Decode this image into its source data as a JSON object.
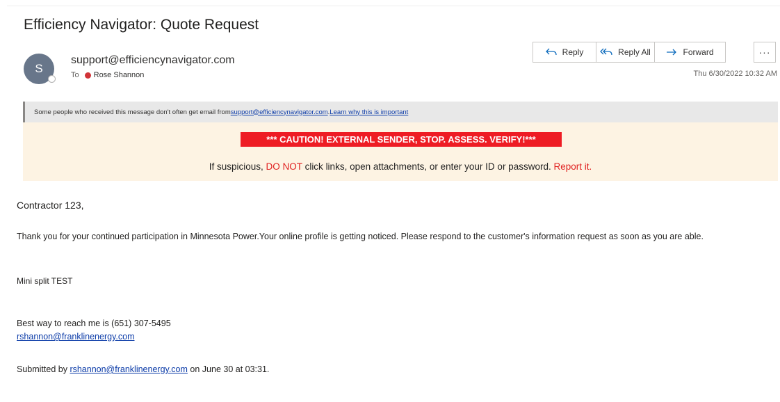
{
  "email": {
    "subject": "Efficiency Navigator: Quote Request",
    "avatar_initial": "S",
    "sender": "support@efficiencynavigator.com",
    "to_label": "To",
    "recipient": "Rose Shannon",
    "timestamp": "Thu 6/30/2022 10:32 AM"
  },
  "actions": {
    "reply": "Reply",
    "reply_all": "Reply All",
    "forward": "Forward",
    "more": "···"
  },
  "info_bar": {
    "text": "Some people who received this message don't often get email from ",
    "sender_link": "support@efficiencynavigator.com",
    "separator": ". ",
    "learn_link": "Learn why this is important"
  },
  "caution": {
    "banner": "*** CAUTION!  EXTERNAL SENDER, STOP. ASSESS. VERIFY!***",
    "line_prefix": "If suspicious, ",
    "do_not": "DO NOT",
    "line_middle": " click links, open attachments, or enter your ID or password. ",
    "report": "Report it."
  },
  "body": {
    "greeting": "Contractor 123,",
    "paragraph": "Thank you for your continued participation in Minnesota Power.Your online profile is getting noticed. Please respond to the customer's information request as soon as you are able.",
    "mini_split": "Mini split TEST",
    "best_way": "Best way to reach me is (651) 307-5495",
    "email_link": "rshannon@franklinenergy.com",
    "submitted_prefix": "Submitted by ",
    "submitted_link": "rshannon@franklinenergy.com",
    "submitted_suffix": " on June 30 at 03:31."
  },
  "colors": {
    "accent": "#0f6cbd",
    "caution_red": "#ee1c24",
    "caution_bg": "#fdf3e3",
    "avatar_bg": "#68768a",
    "presence_red": "#d13438"
  },
  "icons": {
    "reply": "reply-arrow-icon",
    "reply_all": "reply-all-icon",
    "forward": "forward-arrow-icon",
    "more": "more-dots-icon",
    "presence": "presence-status-icon"
  }
}
